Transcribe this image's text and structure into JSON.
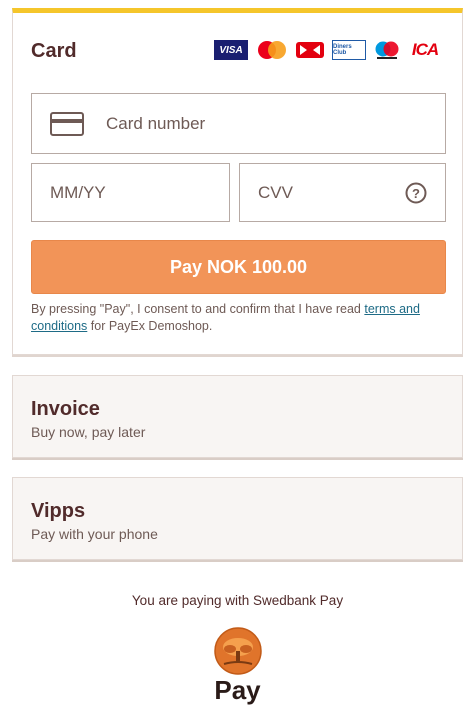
{
  "card": {
    "title": "Card",
    "brands": {
      "visa": "VISA",
      "dankort": "DK",
      "diners": "Diners Club",
      "ica": "ICA"
    },
    "number_placeholder": "Card number",
    "expiry_placeholder": "MM/YY",
    "cvv_placeholder": "CVV",
    "pay_button": "Pay NOK 100.00",
    "consent_prefix": "By pressing \"Pay\", I consent to and confirm that I have read ",
    "consent_link": "terms and conditions",
    "consent_suffix": " for PayEx Demoshop."
  },
  "methods": [
    {
      "title": "Invoice",
      "subtitle": "Buy now, pay later"
    },
    {
      "title": "Vipps",
      "subtitle": "Pay with your phone"
    }
  ],
  "footer": {
    "text": "You are paying with Swedbank Pay",
    "logo_text": "Pay"
  },
  "colors": {
    "accent_top": "#f5c62b",
    "pay_button": "#f29458",
    "text": "#512b2b",
    "link": "#1e6b86"
  }
}
